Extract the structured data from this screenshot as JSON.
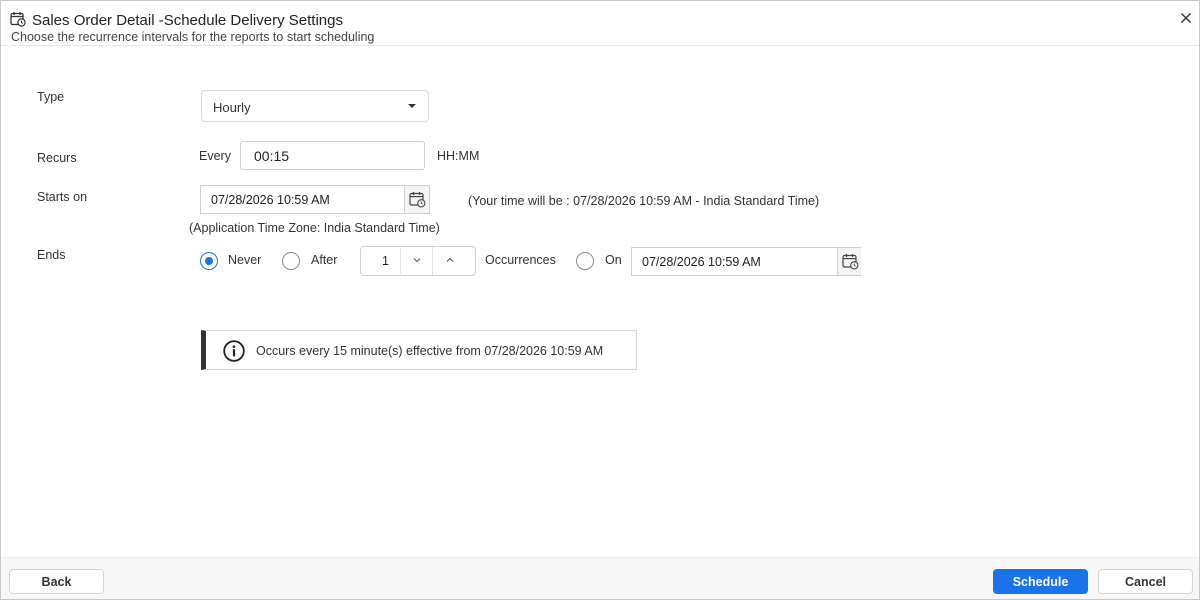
{
  "header": {
    "title": "Sales Order Detail -Schedule Delivery Settings",
    "subtitle": "Choose the recurrence intervals for the reports to start scheduling",
    "icon": "calendar-clock-icon"
  },
  "form": {
    "type": {
      "label": "Type",
      "selected": "Hourly"
    },
    "recurs": {
      "label": "Recurs",
      "prefix": "Every",
      "value": "00:15",
      "unit": "HH:MM"
    },
    "starts_on": {
      "label": "Starts on",
      "value": "07/28/2026 10:59 AM",
      "your_time": "(Your time will be : 07/28/2026 10:59 AM - India Standard Time)",
      "app_timezone": "(Application Time Zone: India Standard Time)"
    },
    "ends": {
      "label": "Ends",
      "never_label": "Never",
      "after_label": "After",
      "occurrences_value": "1",
      "occurrences_label": "Occurrences",
      "on_label": "On",
      "on_date": "07/28/2026 10:59 AM",
      "selected": "never"
    }
  },
  "info": {
    "text": "Occurs every 15 minute(s) effective from 07/28/2026 10:59 AM"
  },
  "footer": {
    "back_label": "Back",
    "schedule_label": "Schedule",
    "cancel_label": "Cancel"
  },
  "colors": {
    "primary": "#1a73e8",
    "border": "#cfcfcf",
    "footer_bg": "#f7f7f7"
  }
}
